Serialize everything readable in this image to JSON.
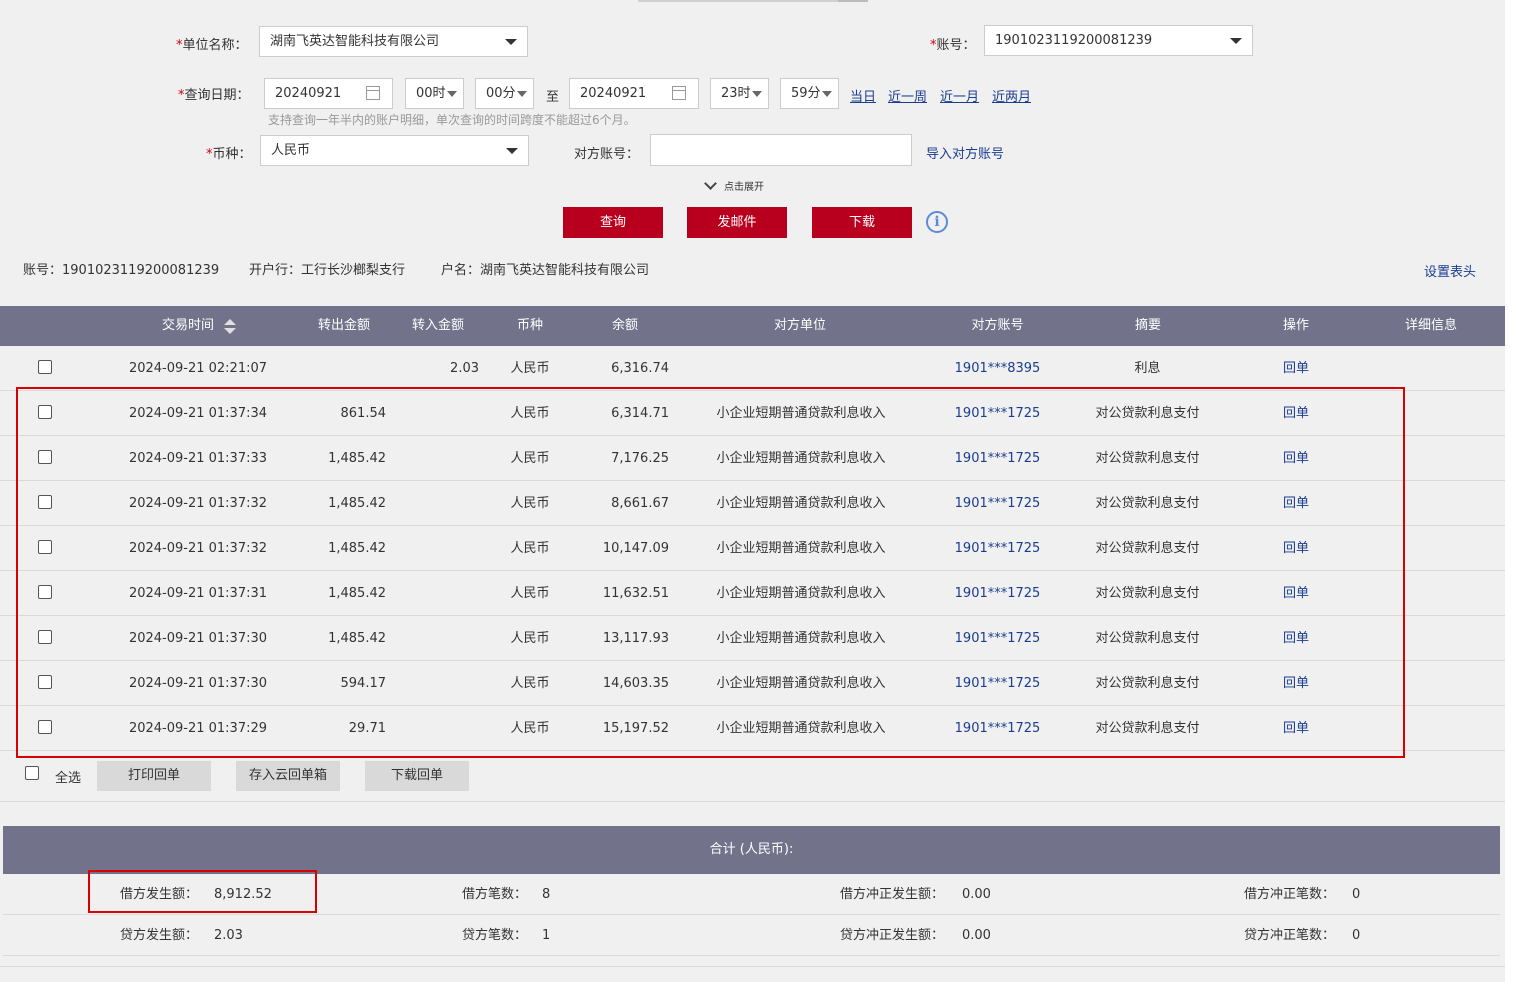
{
  "form": {
    "unit_label": "单位名称：",
    "unit_value": "湖南飞英达智能科技有限公司",
    "account_label": "账号：",
    "account_value": "1901023119200081239",
    "date_label": "查询日期：",
    "start_date": "20240921",
    "start_hour": "00时",
    "start_min": "00分",
    "to_label": "至",
    "end_date": "20240921",
    "end_hour": "23时",
    "end_min": "59分",
    "quick_links": [
      "当日",
      "近一周",
      "近一月",
      "近两月"
    ],
    "date_hint": "支持查询一年半内的账户明细，单次查询的时间跨度不能超过6个月。",
    "currency_label": "币种：",
    "currency_value": "人民币",
    "counter_account_label": "对方账号：",
    "counter_account_value": "",
    "import_link": "导入对方账号",
    "expand_label": "点击展开",
    "required_mark": "*"
  },
  "actions": {
    "query": "查询",
    "email": "发邮件",
    "download": "下载",
    "info_icon": "i"
  },
  "account_info": {
    "account": "账号：1901023119200081239",
    "bank": "开户行：工行长沙榔梨支行",
    "name": "户名：湖南飞英达智能科技有限公司",
    "set_header": "设置表头"
  },
  "table": {
    "headers": [
      "交易时间",
      "转出金额",
      "转入金额",
      "币种",
      "余额",
      "对方单位",
      "对方账号",
      "摘要",
      "操作",
      "详细信息"
    ],
    "rows": [
      {
        "time": "2024-09-21  02:21:07",
        "out": "",
        "in": "2.03",
        "currency": "人民币",
        "balance": "6,316.74",
        "counterparty": "",
        "counter_acct": "1901***8395",
        "summary": "利息",
        "op": "回单"
      },
      {
        "time": "2024-09-21  01:37:34",
        "out": "861.54",
        "in": "",
        "currency": "人民币",
        "balance": "6,314.71",
        "counterparty": "小企业短期普通贷款利息收入",
        "counter_acct": "1901***1725",
        "summary": "对公贷款利息支付",
        "op": "回单"
      },
      {
        "time": "2024-09-21  01:37:33",
        "out": "1,485.42",
        "in": "",
        "currency": "人民币",
        "balance": "7,176.25",
        "counterparty": "小企业短期普通贷款利息收入",
        "counter_acct": "1901***1725",
        "summary": "对公贷款利息支付",
        "op": "回单"
      },
      {
        "time": "2024-09-21  01:37:32",
        "out": "1,485.42",
        "in": "",
        "currency": "人民币",
        "balance": "8,661.67",
        "counterparty": "小企业短期普通贷款利息收入",
        "counter_acct": "1901***1725",
        "summary": "对公贷款利息支付",
        "op": "回单"
      },
      {
        "time": "2024-09-21  01:37:32",
        "out": "1,485.42",
        "in": "",
        "currency": "人民币",
        "balance": "10,147.09",
        "counterparty": "小企业短期普通贷款利息收入",
        "counter_acct": "1901***1725",
        "summary": "对公贷款利息支付",
        "op": "回单"
      },
      {
        "time": "2024-09-21  01:37:31",
        "out": "1,485.42",
        "in": "",
        "currency": "人民币",
        "balance": "11,632.51",
        "counterparty": "小企业短期普通贷款利息收入",
        "counter_acct": "1901***1725",
        "summary": "对公贷款利息支付",
        "op": "回单"
      },
      {
        "time": "2024-09-21  01:37:30",
        "out": "1,485.42",
        "in": "",
        "currency": "人民币",
        "balance": "13,117.93",
        "counterparty": "小企业短期普通贷款利息收入",
        "counter_acct": "1901***1725",
        "summary": "对公贷款利息支付",
        "op": "回单"
      },
      {
        "time": "2024-09-21  01:37:30",
        "out": "594.17",
        "in": "",
        "currency": "人民币",
        "balance": "14,603.35",
        "counterparty": "小企业短期普通贷款利息收入",
        "counter_acct": "1901***1725",
        "summary": "对公贷款利息支付",
        "op": "回单"
      },
      {
        "time": "2024-09-21  01:37:29",
        "out": "29.71",
        "in": "",
        "currency": "人民币",
        "balance": "15,197.52",
        "counterparty": "小企业短期普通贷款利息收入",
        "counter_acct": "1901***1725",
        "summary": "对公贷款利息支付",
        "op": "回单"
      }
    ]
  },
  "bulk": {
    "select_all": "全选",
    "print": "打印回单",
    "save_cloud": "存入云回单箱",
    "download_receipt": "下载回单"
  },
  "summary": {
    "title": "合计 (人民币):",
    "debit_amount_label": "借方发生额：",
    "debit_amount": "8,912.52",
    "debit_count_label": "借方笔数：",
    "debit_count": "8",
    "debit_rev_amount_label": "借方冲正发生额：",
    "debit_rev_amount": "0.00",
    "debit_rev_count_label": "借方冲正笔数：",
    "debit_rev_count": "0",
    "credit_amount_label": "贷方发生额：",
    "credit_amount": "2.03",
    "credit_count_label": "贷方笔数：",
    "credit_count": "1",
    "credit_rev_amount_label": "贷方冲正发生额：",
    "credit_rev_amount": "0.00",
    "credit_rev_count_label": "贷方冲正笔数：",
    "credit_rev_count": "0"
  },
  "colors": {
    "accent_red": "#b8001e",
    "header_bg": "#72738b",
    "link_blue": "#1a3d8f",
    "highlight_red": "#d90000"
  }
}
